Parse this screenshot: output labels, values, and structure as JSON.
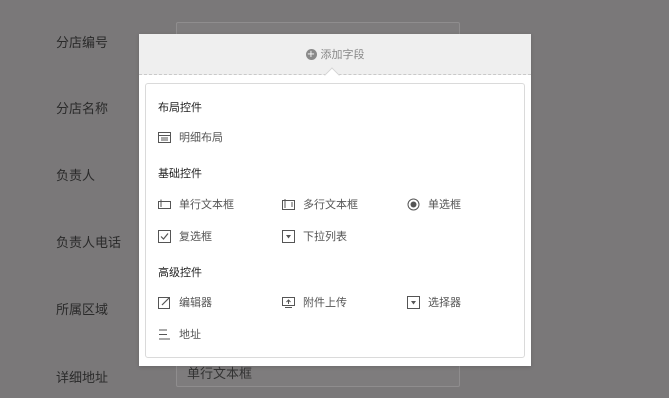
{
  "form": {
    "rows": [
      {
        "label": "分店编号"
      },
      {
        "label": "分店名称"
      },
      {
        "label": "负责人"
      },
      {
        "label": "负责人电话"
      },
      {
        "label": "所属区域"
      },
      {
        "label": "详细地址",
        "field_value": "单行文本框"
      }
    ]
  },
  "popup": {
    "header_label": "添加字段",
    "sections": [
      {
        "title": "布局控件",
        "items": [
          {
            "label": "明细布局",
            "icon": "detail-layout-icon"
          }
        ]
      },
      {
        "title": "基础控件",
        "items": [
          {
            "label": "单行文本框",
            "icon": "single-line-text-icon"
          },
          {
            "label": "多行文本框",
            "icon": "multi-line-text-icon"
          },
          {
            "label": "单选框",
            "icon": "radio-icon"
          },
          {
            "label": "复选框",
            "icon": "checkbox-icon"
          },
          {
            "label": "下拉列表",
            "icon": "dropdown-icon"
          }
        ]
      },
      {
        "title": "高级控件",
        "items": [
          {
            "label": "编辑器",
            "icon": "editor-icon"
          },
          {
            "label": "附件上传",
            "icon": "upload-icon"
          },
          {
            "label": "选择器",
            "icon": "selector-icon"
          },
          {
            "label": "地址",
            "icon": "address-icon"
          }
        ]
      }
    ]
  },
  "colors": {
    "overlay": "#7a7879",
    "popup_bg": "#ffffff",
    "header_bg": "#efefef"
  }
}
